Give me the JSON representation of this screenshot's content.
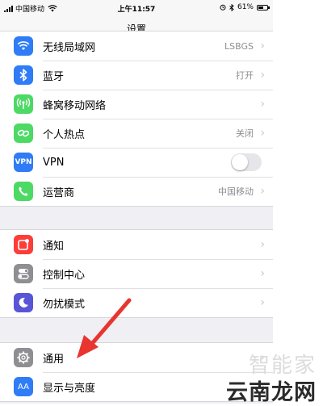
{
  "status_bar": {
    "carrier": "中国移动",
    "time": "上午11:57",
    "battery": "61%",
    "battery_level": 0.61
  },
  "nav": {
    "title": "设置"
  },
  "groups": [
    {
      "rows": [
        {
          "label": "无线局域网",
          "value": "LSBGS",
          "icon": "wifi-icon",
          "color": "#2f7cf6"
        },
        {
          "label": "蓝牙",
          "value": "打开",
          "icon": "bluetooth-icon",
          "color": "#2f7cf6"
        },
        {
          "label": "蜂窝移动网络",
          "value": "",
          "icon": "cellular-icon",
          "color": "#4cd964"
        },
        {
          "label": "个人热点",
          "value": "关闭",
          "icon": "hotspot-icon",
          "color": "#4cd964"
        },
        {
          "label": "VPN",
          "icon_text": "VPN",
          "icon": "vpn-icon",
          "color": "#2f7cf6",
          "toggle": false
        },
        {
          "label": "运营商",
          "value": "中国移动",
          "icon": "carrier-phone-icon",
          "color": "#4cd964"
        }
      ]
    },
    {
      "rows": [
        {
          "label": "通知",
          "icon": "notifications-icon",
          "color": "#fc3d39"
        },
        {
          "label": "控制中心",
          "icon": "control-center-icon",
          "color": "#8e8e93"
        },
        {
          "label": "勿扰模式",
          "icon": "moon-icon",
          "color": "#5856d6"
        }
      ]
    },
    {
      "rows": [
        {
          "label": "通用",
          "icon": "gear-icon",
          "color": "#8e8e93"
        },
        {
          "label": "显示与亮度",
          "icon_text": "AA",
          "icon": "display-icon",
          "color": "#2f7cf6"
        }
      ]
    }
  ],
  "watermark": {
    "top": "智能家",
    "bottom": "云南龙网"
  }
}
